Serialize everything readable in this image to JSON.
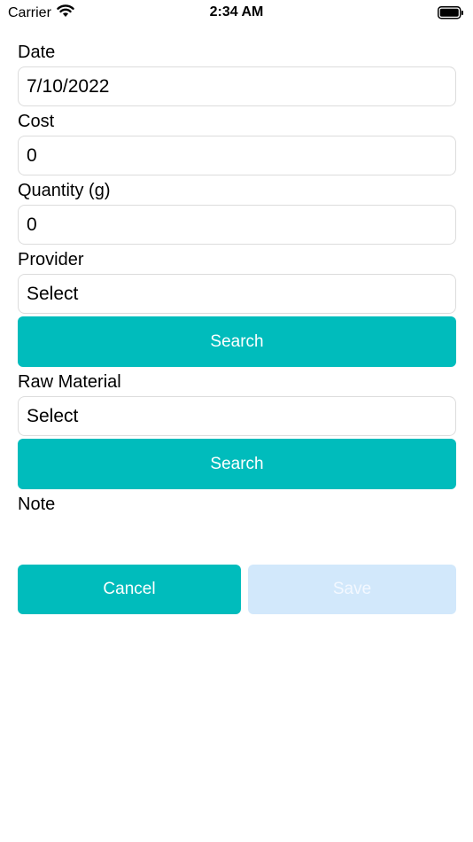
{
  "status_bar": {
    "carrier": "Carrier",
    "time": "2:34 AM"
  },
  "form": {
    "date": {
      "label": "Date",
      "value": "7/10/2022"
    },
    "cost": {
      "label": "Cost",
      "value": "0"
    },
    "quantity": {
      "label": "Quantity (g)",
      "value": "0"
    },
    "provider": {
      "label": "Provider",
      "value": "Select",
      "search_label": "Search"
    },
    "raw_material": {
      "label": "Raw Material",
      "value": "Select",
      "search_label": "Search"
    },
    "note": {
      "label": "Note"
    }
  },
  "actions": {
    "cancel_label": "Cancel",
    "save_label": "Save"
  },
  "colors": {
    "accent": "#00bcbc",
    "disabled": "#d2e8fb",
    "field_border": "#dcdcdc"
  }
}
